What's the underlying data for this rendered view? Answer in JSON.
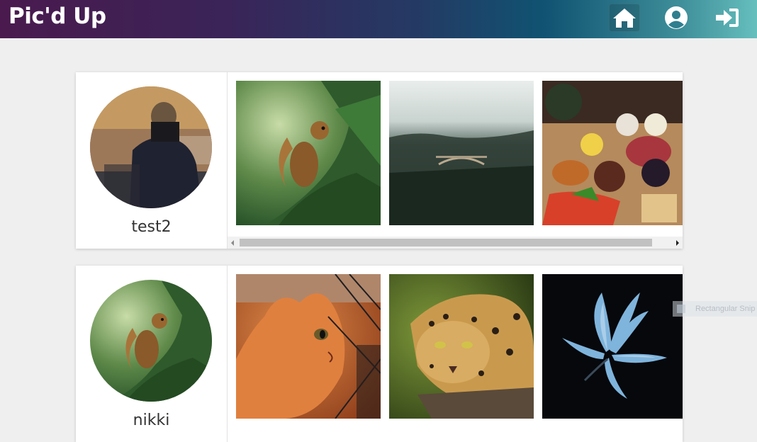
{
  "header": {
    "brand": "Pic'd Up",
    "nav": [
      {
        "icon": "home-icon"
      },
      {
        "icon": "user-circle-icon"
      },
      {
        "icon": "sign-in-icon"
      }
    ]
  },
  "feed": [
    {
      "username": "test2",
      "avatar": "person-reflection-photo",
      "photos": [
        "squirrel-in-pine-tree",
        "misty-forest-bridge",
        "charcuterie-board"
      ]
    },
    {
      "username": "nikki",
      "avatar": "squirrel-in-pine-tree",
      "photos": [
        "orange-cat-at-fence",
        "leopard-on-branch",
        "blue-flower-on-black"
      ]
    }
  ],
  "overlay": {
    "snip_label": "Rectangular Snip"
  },
  "colors": {
    "header_gradient": [
      "#4a1a4e",
      "#105372",
      "#66bfbd"
    ],
    "page_bg": "#efefef",
    "card_bg": "#ffffff"
  }
}
